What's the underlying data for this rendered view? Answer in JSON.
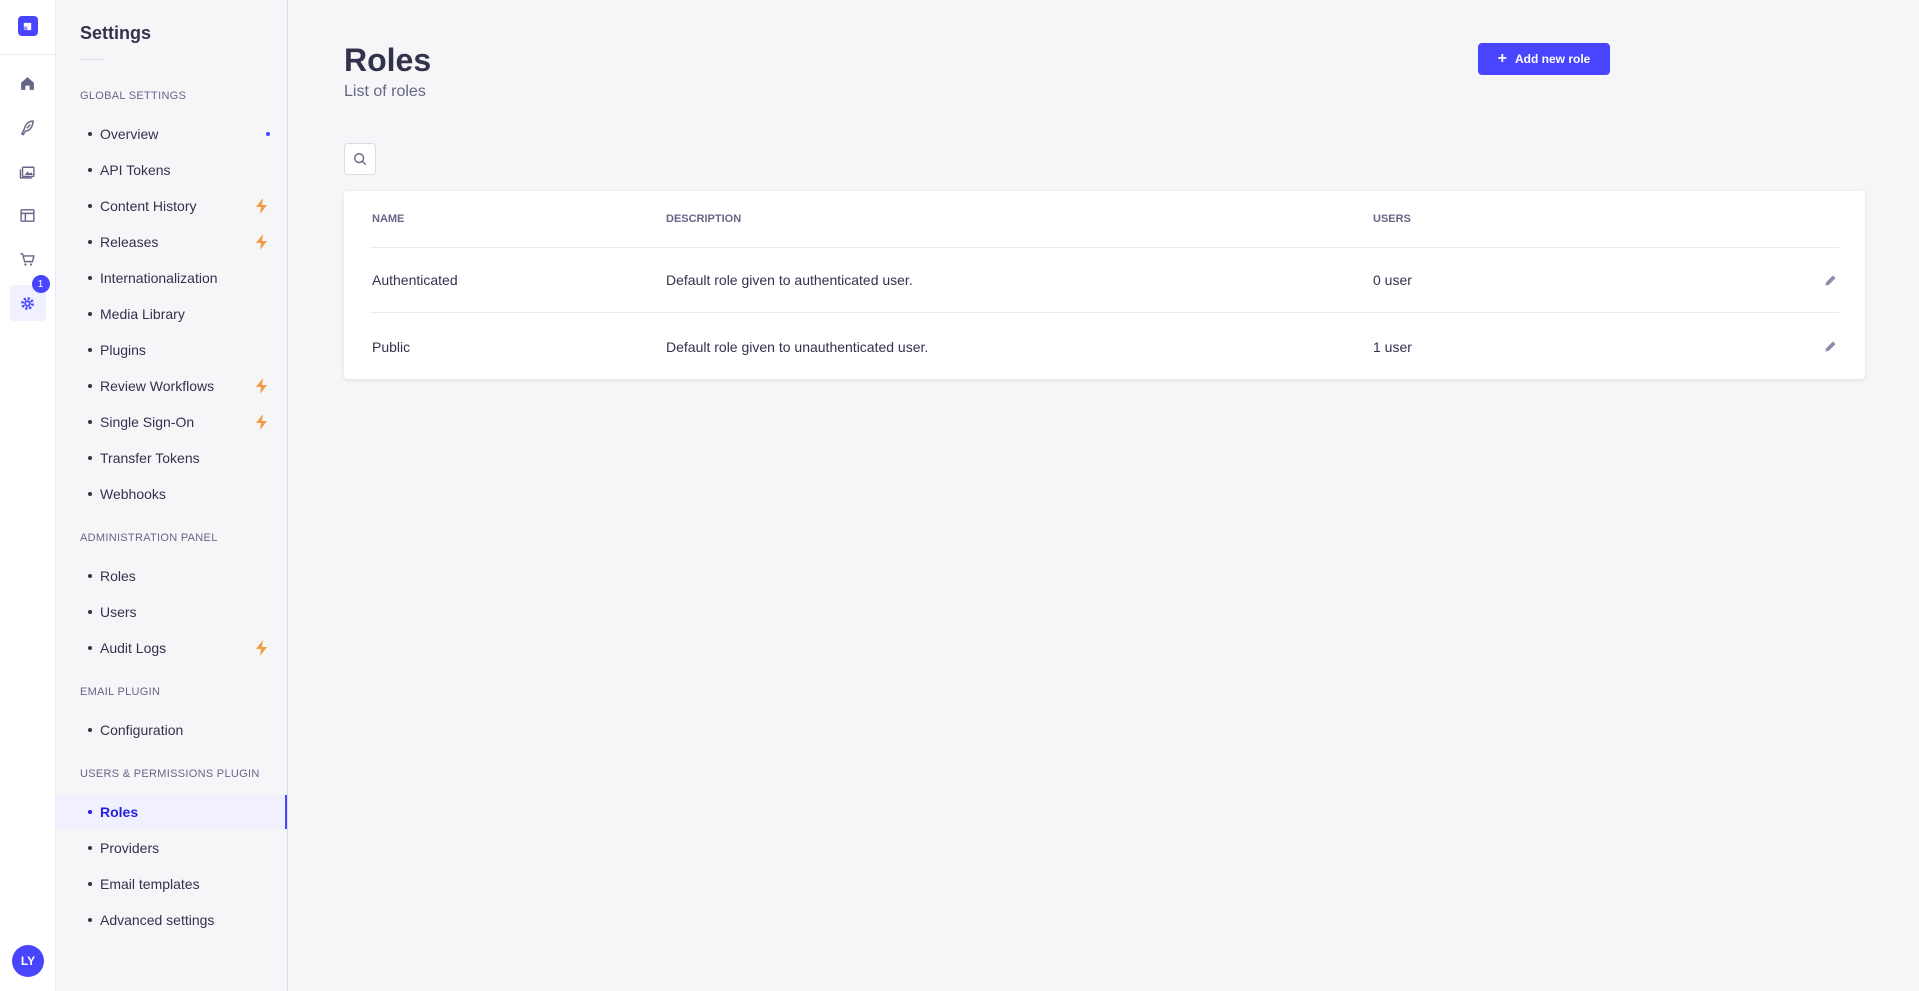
{
  "rail": {
    "icons": [
      "home-icon",
      "feather-icon",
      "images-icon",
      "layout-icon",
      "cart-icon",
      "cog-icon"
    ],
    "settings_badge": "1",
    "avatar_initials": "LY"
  },
  "subnav": {
    "title": "Settings",
    "sections": [
      {
        "label": "Global Settings",
        "items": [
          "Overview",
          "API Tokens",
          "Content History",
          "Releases",
          "Internationalization",
          "Media Library",
          "Plugins",
          "Review Workflows",
          "Single Sign-On",
          "Transfer Tokens",
          "Webhooks"
        ]
      },
      {
        "label": "Administration Panel",
        "items": [
          "Roles",
          "Users",
          "Audit Logs"
        ]
      },
      {
        "label": "Email Plugin",
        "items": [
          "Configuration"
        ]
      },
      {
        "label": "Users & Permissions Plugin",
        "items": [
          "Roles",
          "Providers",
          "Email templates",
          "Advanced settings"
        ]
      }
    ]
  },
  "main": {
    "title": "Roles",
    "subtitle": "List of roles",
    "add_button_label": "Add new role",
    "table": {
      "headers": [
        "Name",
        "Description",
        "Users"
      ],
      "rows": [
        {
          "name": "Authenticated",
          "description": "Default role given to authenticated user.",
          "users": "0 user"
        },
        {
          "name": "Public",
          "description": "Default role given to unauthenticated user.",
          "users": "1 user"
        }
      ]
    }
  },
  "colors": {
    "primary": "#4945ff",
    "lightning": "#f29d41",
    "background": "#f6f6f9"
  }
}
